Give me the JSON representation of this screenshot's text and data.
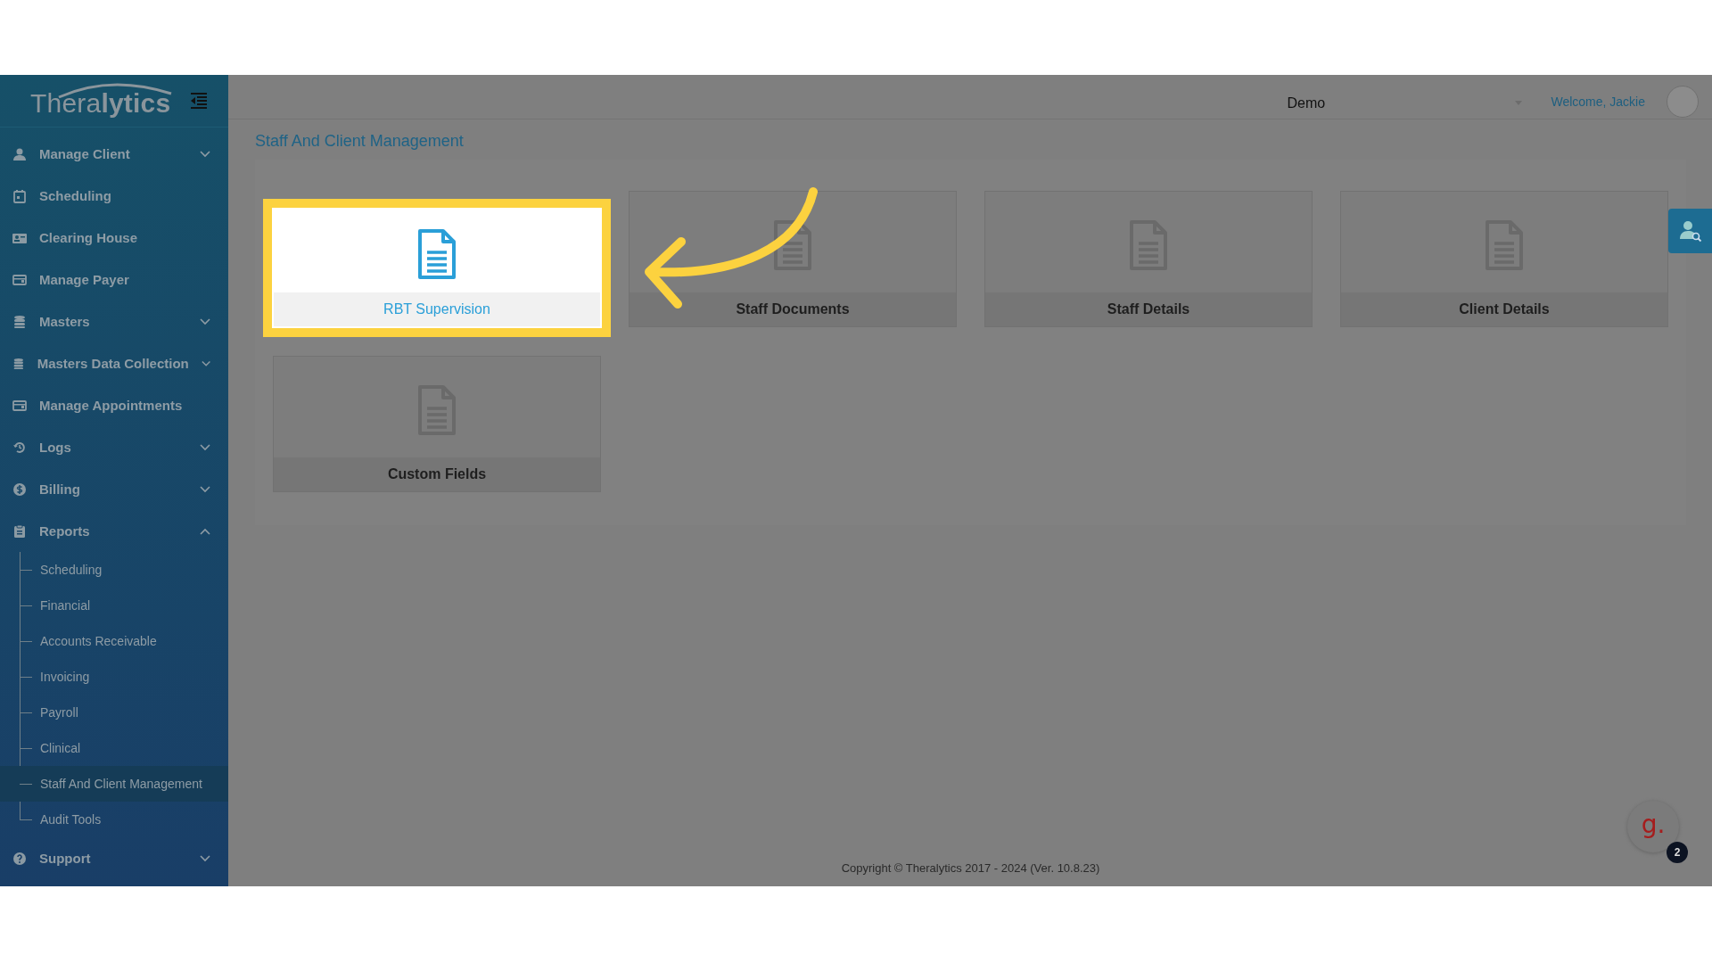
{
  "logo": "Thera**lytics**",
  "sidebar": {
    "items": [
      {
        "label": "Manage Client",
        "expanded": false
      },
      {
        "label": "Scheduling"
      },
      {
        "label": "Clearing House"
      },
      {
        "label": "Manage Payer"
      },
      {
        "label": "Masters",
        "expanded": false
      },
      {
        "label": "Masters Data Collection",
        "expanded": false
      },
      {
        "label": "Manage Appointments"
      },
      {
        "label": "Logs",
        "expanded": false
      },
      {
        "label": "Billing",
        "expanded": false
      },
      {
        "label": "Reports",
        "expanded": true,
        "children": [
          {
            "label": "Scheduling",
            "selected": false
          },
          {
            "label": "Financial",
            "selected": false
          },
          {
            "label": "Accounts Receivable",
            "selected": false
          },
          {
            "label": "Invoicing",
            "selected": false
          },
          {
            "label": "Payroll",
            "selected": false
          },
          {
            "label": "Clinical",
            "selected": false
          },
          {
            "label": "Staff And Client Management",
            "selected": true
          },
          {
            "label": "Audit Tools",
            "selected": false
          }
        ]
      },
      {
        "label": "Support",
        "expanded": false
      }
    ]
  },
  "header": {
    "company": "Demo",
    "welcome": "Welcome, Jackie"
  },
  "page_title": "Staff And Client Management",
  "cards": [
    {
      "label": "RBT Supervision",
      "highlighted": true
    },
    {
      "label": "Staff Documents",
      "highlighted": false
    },
    {
      "label": "Staff Details",
      "highlighted": false
    },
    {
      "label": "Client Details",
      "highlighted": false
    },
    {
      "label": "Custom Fields",
      "highlighted": false
    }
  ],
  "footer": "Copyright © Theralytics 2017 - 2024 (Ver. 10.8.23)",
  "chat_widget": {
    "logo": "g.",
    "badge": "2"
  }
}
